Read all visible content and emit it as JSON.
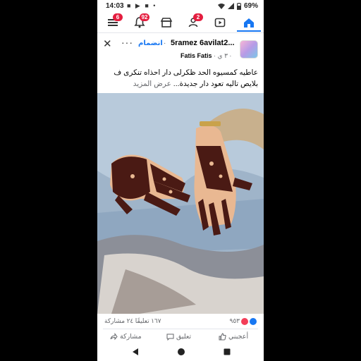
{
  "status_bar": {
    "time": "14:03",
    "notif_icons": "■ ▶ ■ •",
    "battery": "69%"
  },
  "nav": {
    "menu_badge": "6",
    "notifications_badge": "92",
    "watch_badge": "2"
  },
  "post": {
    "group_name": "5ramez 6avilat2...",
    "join_label": "انضمام",
    "more_label": "···",
    "author_name": "Fatis Fatis",
    "author_meta": "· ٣ ي ·",
    "text_line1": "عاطيه كمسيوه الحد ظكرلى دار احذاه تنكرى ف",
    "text_line2": "بلايص تاليه تعود دار جديدة...",
    "see_more": "عرض المزيد"
  },
  "reactions": {
    "count": "٩٥٣",
    "summary": "١٦٧ تعليقًا ٢٤ مشاركة"
  },
  "actions": {
    "like": "أعجبني",
    "comment": "تعليق",
    "share": "مشاركة"
  },
  "colors": {
    "brand_blue": "#1877f2",
    "badge_red": "#e41e3f",
    "henna": "#4a1a14"
  }
}
